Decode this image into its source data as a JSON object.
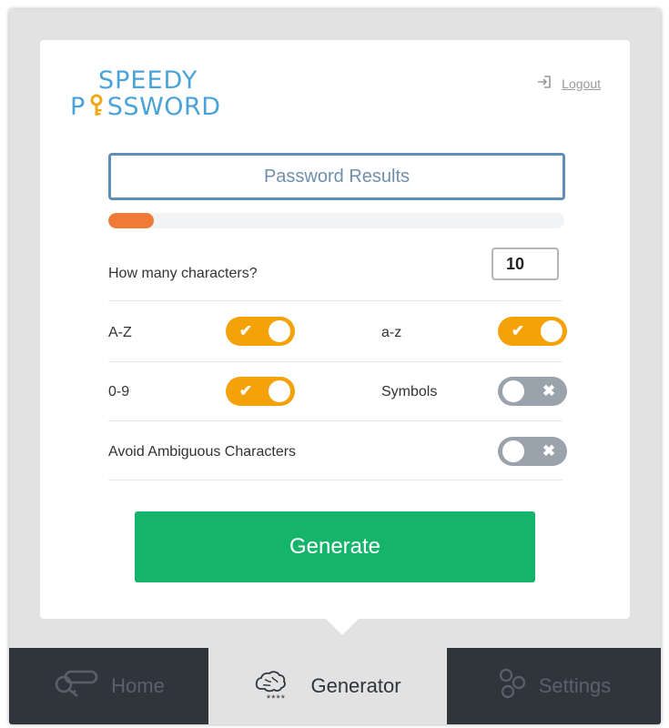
{
  "logo": {
    "line1": "SPEEDY",
    "line2_a": "P",
    "line2_b": "SSWORD"
  },
  "header": {
    "logout_label": "Logout"
  },
  "result": {
    "placeholder": "Password Results"
  },
  "strength": {
    "fraction": 0.1,
    "color": "#ef7b36"
  },
  "length": {
    "label": "How many characters?",
    "value": "10"
  },
  "options": {
    "uppercase": {
      "label": "A-Z",
      "enabled": true
    },
    "lowercase": {
      "label": "a-z",
      "enabled": true
    },
    "digits": {
      "label": "0-9",
      "enabled": true
    },
    "symbols": {
      "label": "Symbols",
      "enabled": false
    },
    "avoid_ambiguous": {
      "label": "Avoid Ambiguous Characters",
      "enabled": false
    }
  },
  "toggle_marks": {
    "on": "✔",
    "off": "✖"
  },
  "generate": {
    "label": "Generate",
    "color": "#14b56a"
  },
  "nav": {
    "home": "Home",
    "generator": "Generator",
    "settings": "Settings",
    "generator_dots": "****"
  },
  "colors": {
    "toggle_on": "#f5a20a",
    "toggle_off": "#9aa2ab",
    "accent": "#4aa3d8"
  }
}
